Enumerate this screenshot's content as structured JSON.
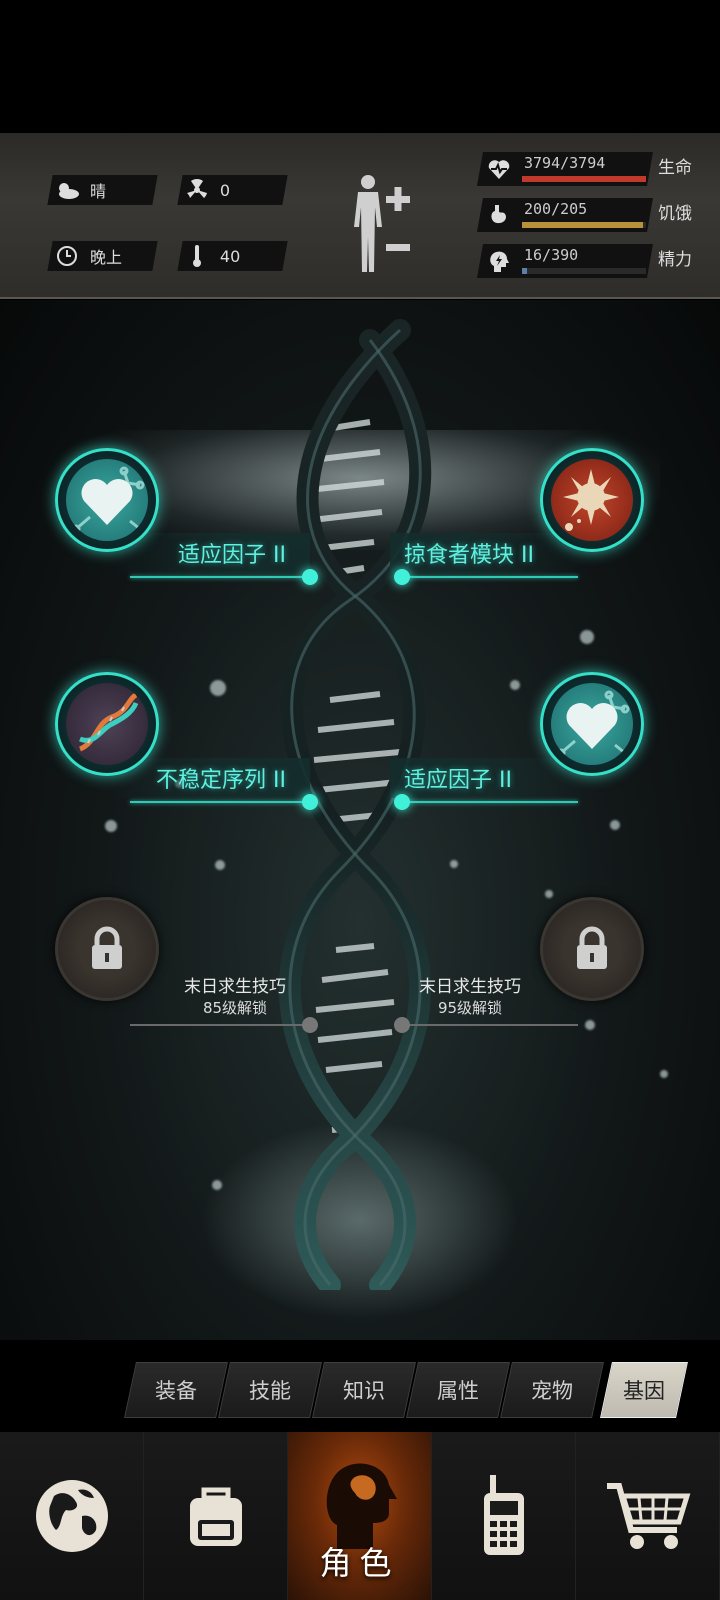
{
  "status": {
    "weather": "晴",
    "radiation": "0",
    "time_of_day": "晚上",
    "temperature": "40"
  },
  "vitals": [
    {
      "icon": "heart-pulse-icon",
      "value": "3794/3794",
      "label": "生命",
      "fraction": 1.0,
      "color": "#c0392b"
    },
    {
      "icon": "stomach-icon",
      "value": "200/205",
      "label": "饥饿",
      "fraction": 0.976,
      "color": "#b8923a"
    },
    {
      "icon": "energy-head-icon",
      "value": "16/390",
      "label": "精力",
      "fraction": 0.041,
      "color": "#5b7fa8"
    }
  ],
  "genes": {
    "slot1": {
      "label": "适应因子 II",
      "icon": "heart-cell-icon"
    },
    "slot2": {
      "label": "掠食者模块 II",
      "icon": "spiked-virus-icon"
    },
    "slot3": {
      "label": "不稳定序列 II",
      "icon": "dna-strand-icon"
    },
    "slot4": {
      "label": "适应因子 II",
      "icon": "heart-cell-icon"
    },
    "slot5": {
      "name": "末日求生技巧",
      "unlock": "85级解锁",
      "icon": "lock-icon"
    },
    "slot6": {
      "name": "末日求生技巧",
      "unlock": "95级解锁",
      "icon": "lock-icon"
    }
  },
  "tabs": [
    "装备",
    "技能",
    "知识",
    "属性",
    "宠物",
    "基因"
  ],
  "selected_tab": "基因",
  "nav": {
    "items": [
      "globe-icon",
      "backpack-icon",
      "character-icon",
      "walkie-talkie-icon",
      "cart-icon"
    ],
    "active_label": "角色"
  },
  "colors": {
    "accent": "#40f0d8",
    "active_nav": "#b04a10"
  }
}
